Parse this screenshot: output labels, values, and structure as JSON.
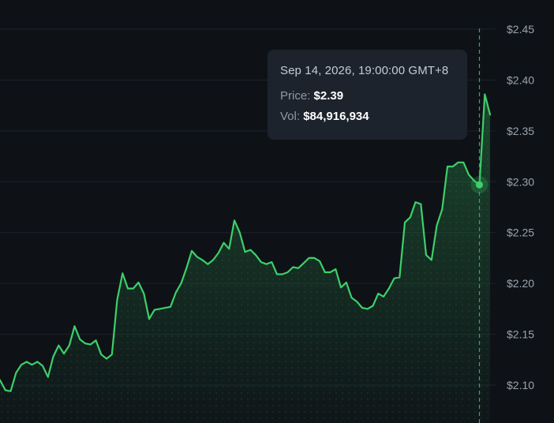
{
  "colors": {
    "background": "#0e1217",
    "line": "#3ecf6a",
    "grid": "#1c232b",
    "axis_text": "#9aa3ad",
    "tooltip_bg": "#1d232c"
  },
  "tooltip": {
    "date": "Sep 14, 2026, 19:00:00 GMT+8",
    "price_label": "Price:",
    "price_value": "$2.39",
    "vol_label": "Vol:",
    "vol_value": "$84,916,934"
  },
  "chart_data": {
    "type": "area",
    "y_ticks": [
      "$2.45",
      "$2.40",
      "$2.35",
      "$2.30",
      "$2.25",
      "$2.20",
      "$2.15",
      "$2.10"
    ],
    "y_tick_values": [
      2.45,
      2.4,
      2.35,
      2.3,
      2.25,
      2.2,
      2.15,
      2.1
    ],
    "ylim": [
      2.07,
      2.453
    ],
    "grid": true,
    "hovered_index": 90,
    "series": [
      {
        "values": [
          2.105,
          2.095,
          2.094,
          2.112,
          2.12,
          2.123,
          2.12,
          2.123,
          2.119,
          2.108,
          2.128,
          2.139,
          2.131,
          2.139,
          2.158,
          2.145,
          2.141,
          2.14,
          2.144,
          2.13,
          2.126,
          2.13,
          2.184,
          2.21,
          2.195,
          2.195,
          2.201,
          2.19,
          2.165,
          2.174,
          2.175,
          2.176,
          2.177,
          2.191,
          2.2,
          2.215,
          2.232,
          2.226,
          2.223,
          2.219,
          2.223,
          2.23,
          2.24,
          2.234,
          2.262,
          2.25,
          2.231,
          2.233,
          2.228,
          2.221,
          2.219,
          2.221,
          2.209,
          2.209,
          2.211,
          2.216,
          2.215,
          2.22,
          2.225,
          2.225,
          2.222,
          2.211,
          2.211,
          2.214,
          2.196,
          2.201,
          2.186,
          2.182,
          2.176,
          2.175,
          2.178,
          2.19,
          2.187,
          2.195,
          2.205,
          2.206,
          2.26,
          2.265,
          2.28,
          2.278,
          2.228,
          2.223,
          2.257,
          2.273,
          2.315,
          2.315,
          2.319,
          2.319,
          2.307,
          2.301,
          2.297,
          2.386,
          2.366
        ]
      }
    ]
  }
}
